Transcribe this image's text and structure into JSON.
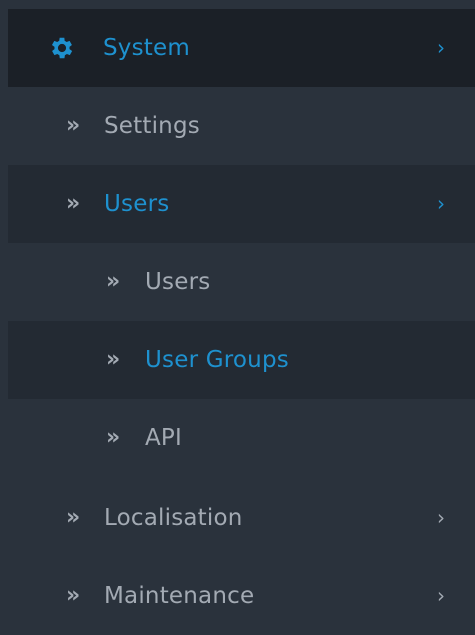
{
  "colors": {
    "background": "#2a323c",
    "header_background": "#1b2027",
    "active_background": "#232a33",
    "accent": "#1e91cf",
    "text": "#a3aab3"
  },
  "menu": {
    "header": {
      "label": "System",
      "icon": "gear-icon",
      "expanded": true
    },
    "items": [
      {
        "label": "Settings",
        "icon": "double-chevron-right-icon",
        "level": 1,
        "active": false,
        "has_children": false
      },
      {
        "label": "Users",
        "icon": "double-chevron-right-icon",
        "level": 1,
        "active": true,
        "has_children": true
      },
      {
        "label": "Users",
        "icon": "double-chevron-right-icon",
        "level": 2,
        "active": false,
        "has_children": false
      },
      {
        "label": "User Groups",
        "icon": "double-chevron-right-icon",
        "level": 2,
        "active": true,
        "has_children": false
      },
      {
        "label": "API",
        "icon": "double-chevron-right-icon",
        "level": 2,
        "active": false,
        "has_children": false
      },
      {
        "label": "Localisation",
        "icon": "double-chevron-right-icon",
        "level": 1,
        "active": false,
        "has_children": true
      },
      {
        "label": "Maintenance",
        "icon": "double-chevron-right-icon",
        "level": 1,
        "active": false,
        "has_children": true
      }
    ]
  }
}
